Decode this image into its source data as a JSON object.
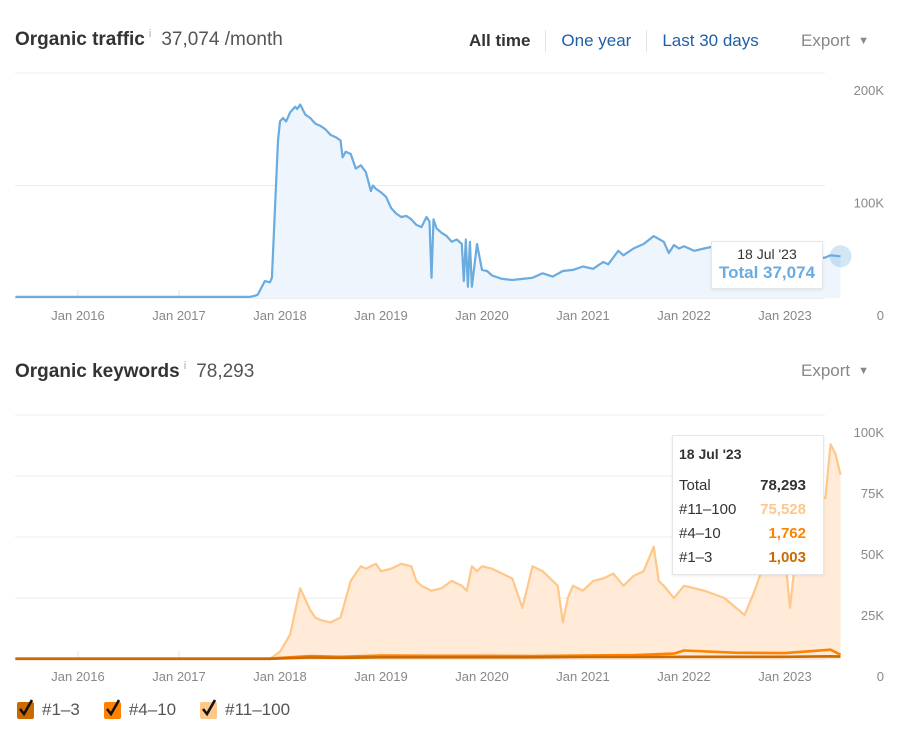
{
  "traffic": {
    "title": "Organic traffic",
    "info_icon": "i",
    "value": "37,074 /month",
    "tabs": [
      {
        "label": "All time",
        "active": true
      },
      {
        "label": "One year",
        "active": false
      },
      {
        "label": "Last 30 days",
        "active": false
      }
    ],
    "export_label": "Export",
    "tooltip": {
      "date": "18 Jul '23",
      "total": "Total 37,074"
    }
  },
  "keywords": {
    "title": "Organic keywords",
    "info_icon": "i",
    "value": "78,293",
    "export_label": "Export",
    "tooltip": {
      "date": "18 Jul '23",
      "rows": [
        {
          "label": "Total",
          "value": "78,293",
          "color": "#333333"
        },
        {
          "label": "#11–100",
          "value": "75,528",
          "color": "#ffc78a"
        },
        {
          "label": "#4–10",
          "value": "1,762",
          "color": "#ff8200"
        },
        {
          "label": "#1–3",
          "value": "1,003",
          "color": "#cc6a00"
        }
      ]
    },
    "legend": [
      {
        "label": "#1–3",
        "color": "#cc6a00",
        "checked": true
      },
      {
        "label": "#4–10",
        "color": "#ff8200",
        "checked": true
      },
      {
        "label": "#11–100",
        "color": "#ffc78a",
        "checked": true
      }
    ]
  },
  "chart_data": [
    {
      "type": "area",
      "title": "Organic traffic",
      "xlabel": "",
      "ylabel": "",
      "x_ticks": [
        "Jan 2016",
        "Jan 2017",
        "Jan 2018",
        "Jan 2019",
        "Jan 2020",
        "Jan 2021",
        "Jan 2022",
        "Jan 2023"
      ],
      "y_ticks": [
        "0",
        "100K",
        "200K"
      ],
      "ylim": [
        0,
        200000
      ],
      "xlim": [
        2015.25,
        2023.75
      ],
      "grid": true,
      "color": "#6aabe0",
      "series": [
        {
          "name": "Organic traffic",
          "x": [
            2015.38,
            2017.7,
            2017.75,
            2017.78,
            2017.85,
            2017.9,
            2017.92,
            2017.98,
            2018.0,
            2018.03,
            2018.06,
            2018.1,
            2018.15,
            2018.17,
            2018.2,
            2018.25,
            2018.3,
            2018.35,
            2018.4,
            2018.45,
            2018.5,
            2018.55,
            2018.6,
            2018.62,
            2018.65,
            2018.7,
            2018.75,
            2018.8,
            2018.85,
            2018.9,
            2018.92,
            2018.95,
            2019.0,
            2019.05,
            2019.1,
            2019.15,
            2019.2,
            2019.25,
            2019.3,
            2019.35,
            2019.4,
            2019.45,
            2019.48,
            2019.5,
            2019.52,
            2019.55,
            2019.6,
            2019.65,
            2019.7,
            2019.75,
            2019.8,
            2019.82,
            2019.84,
            2019.86,
            2019.88,
            2019.9,
            2019.95,
            2020.0,
            2020.05,
            2020.1,
            2020.2,
            2020.3,
            2020.4,
            2020.5,
            2020.6,
            2020.7,
            2020.8,
            2020.9,
            2021.0,
            2021.1,
            2021.2,
            2021.25,
            2021.3,
            2021.35,
            2021.4,
            2021.5,
            2021.6,
            2021.7,
            2021.8,
            2021.85,
            2021.9,
            2021.95,
            2022.0,
            2022.1,
            2022.2,
            2022.3,
            2022.5,
            2022.7,
            2022.9,
            2023.0,
            2023.2,
            2023.3,
            2023.4,
            2023.45,
            2023.55
          ],
          "y": [
            1000,
            1000,
            2000,
            3000,
            15000,
            14000,
            18000,
            140000,
            157000,
            160000,
            157000,
            165000,
            170000,
            168000,
            172000,
            163000,
            160000,
            155000,
            153000,
            150000,
            145000,
            143000,
            140000,
            125000,
            130000,
            128000,
            115000,
            118000,
            112000,
            95000,
            100000,
            97000,
            94000,
            90000,
            80000,
            75000,
            72000,
            73000,
            70000,
            65000,
            63000,
            72000,
            68000,
            18000,
            70000,
            62000,
            58000,
            55000,
            50000,
            52000,
            48000,
            15000,
            52000,
            10000,
            50000,
            10000,
            48000,
            25000,
            24000,
            20000,
            17000,
            16000,
            17000,
            18000,
            22000,
            19000,
            24000,
            25000,
            28000,
            26000,
            32000,
            30000,
            36000,
            42000,
            38000,
            44000,
            48000,
            55000,
            50000,
            40000,
            47000,
            44000,
            46000,
            42000,
            44000,
            46000,
            41000,
            41000,
            40000,
            40000,
            38000,
            35000,
            36000,
            38000,
            37074
          ]
        }
      ]
    },
    {
      "type": "area",
      "title": "Organic keywords",
      "xlabel": "",
      "ylabel": "",
      "x_ticks": [
        "Jan 2016",
        "Jan 2017",
        "Jan 2018",
        "Jan 2019",
        "Jan 2020",
        "Jan 2021",
        "Jan 2022",
        "Jan 2023"
      ],
      "y_ticks": [
        "0",
        "25K",
        "50K",
        "75K",
        "100K"
      ],
      "ylim": [
        0,
        100000
      ],
      "xlim": [
        2015.25,
        2023.75
      ],
      "grid": true,
      "series": [
        {
          "name": "#11–100",
          "color": "#ffc78a",
          "x": [
            2015.38,
            2017.9,
            2018.0,
            2018.1,
            2018.2,
            2018.3,
            2018.35,
            2018.4,
            2018.5,
            2018.6,
            2018.7,
            2018.8,
            2018.85,
            2018.9,
            2018.95,
            2019.0,
            2019.1,
            2019.2,
            2019.3,
            2019.35,
            2019.4,
            2019.5,
            2019.6,
            2019.7,
            2019.8,
            2019.85,
            2019.9,
            2019.95,
            2020.0,
            2020.1,
            2020.2,
            2020.3,
            2020.4,
            2020.5,
            2020.6,
            2020.7,
            2020.75,
            2020.8,
            2020.85,
            2020.9,
            2021.0,
            2021.1,
            2021.2,
            2021.3,
            2021.4,
            2021.5,
            2021.6,
            2021.7,
            2021.75,
            2021.8,
            2021.9,
            2022.0,
            2022.1,
            2022.2,
            2022.4,
            2022.6,
            2022.7,
            2022.8,
            2022.85,
            2022.9,
            2023.0,
            2023.05,
            2023.1,
            2023.2,
            2023.3,
            2023.4,
            2023.45,
            2023.5,
            2023.55
          ],
          "y": [
            0,
            0,
            3000,
            10000,
            29000,
            20000,
            17000,
            16000,
            15000,
            17000,
            32000,
            38000,
            37000,
            38000,
            39000,
            36000,
            37000,
            39000,
            38000,
            32000,
            30000,
            28000,
            29000,
            32000,
            30000,
            28000,
            38000,
            36000,
            38000,
            37000,
            35000,
            33000,
            21000,
            38000,
            36000,
            32000,
            30000,
            15000,
            25000,
            30000,
            28000,
            32000,
            33000,
            35000,
            30000,
            34000,
            36000,
            46000,
            32000,
            30000,
            25000,
            30000,
            29000,
            28000,
            25000,
            18000,
            28000,
            40000,
            46000,
            38000,
            42000,
            21000,
            40000,
            62000,
            67000,
            66000,
            88000,
            84000,
            75528
          ]
        },
        {
          "name": "#4–10",
          "color": "#ff8200",
          "x": [
            2015.38,
            2017.9,
            2018.3,
            2018.6,
            2019.0,
            2019.5,
            2020.0,
            2020.5,
            2021.0,
            2021.5,
            2021.9,
            2022.0,
            2022.5,
            2023.0,
            2023.45,
            2023.55
          ],
          "y": [
            200,
            200,
            1200,
            900,
            1400,
            1300,
            1300,
            1200,
            1400,
            1600,
            2200,
            3500,
            2600,
            2400,
            3800,
            1762
          ]
        },
        {
          "name": "#1–3",
          "color": "#cc6a00",
          "x": [
            2015.38,
            2017.9,
            2018.3,
            2018.6,
            2019.0,
            2019.5,
            2020.0,
            2020.5,
            2021.0,
            2021.5,
            2022.0,
            2022.5,
            2023.0,
            2023.45,
            2023.55
          ],
          "y": [
            100,
            100,
            600,
            500,
            700,
            700,
            700,
            700,
            800,
            800,
            900,
            900,
            900,
            1100,
            1003
          ]
        }
      ]
    }
  ]
}
